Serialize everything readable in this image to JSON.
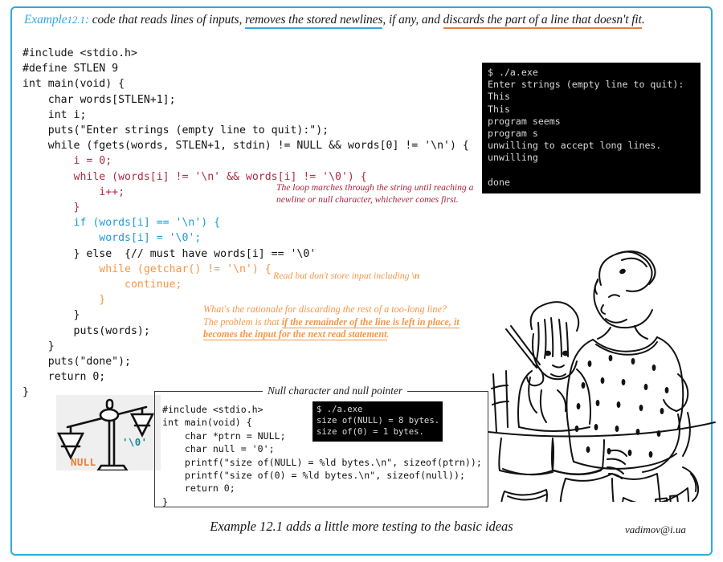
{
  "frame": {
    "border_color": "#2DA9E1"
  },
  "header": {
    "example_label": "Example",
    "example_number": "12.1",
    "colon": ":",
    "part1": " code that reads lines of inputs, ",
    "underline_blue": "removes the stored newlines",
    "part2": ", if any, and ",
    "underline_orange": "discards the part of a line that doesn't fit",
    "part3": "."
  },
  "main_code": {
    "lines": [
      {
        "text": "#include <stdio.h>",
        "color": "black"
      },
      {
        "text": "#define STLEN 9",
        "color": "black"
      },
      {
        "text": "int main(void) {",
        "color": "black"
      },
      {
        "text": "    char words[STLEN+1];",
        "color": "black"
      },
      {
        "text": "    int i;",
        "color": "black"
      },
      {
        "text": "    puts(\"Enter strings (empty line to quit):\");",
        "color": "black"
      },
      {
        "text": "    while (fgets(words, STLEN+1, stdin) != NULL && words[0] != '\\n') {",
        "color": "black"
      },
      {
        "text": "        i = 0;",
        "color": "red"
      },
      {
        "text": "        while (words[i] != '\\n' && words[i] != '\\0') {",
        "color": "red"
      },
      {
        "text": "            i++;",
        "color": "red"
      },
      {
        "text": "        }",
        "color": "red"
      },
      {
        "text": "        if (words[i] == '\\n') {",
        "color": "blue"
      },
      {
        "text": "            words[i] = '\\0';",
        "color": "blue"
      },
      {
        "text": "        } else  {// must have words[i] == '\\0'",
        "color": "black"
      },
      {
        "text": "            while (getchar() != '\\n') {",
        "color": "orange"
      },
      {
        "text": "                continue;",
        "color": "orange"
      },
      {
        "text": "            }",
        "color": "orange"
      },
      {
        "text": "        }",
        "color": "black"
      },
      {
        "text": "        puts(words);",
        "color": "black"
      },
      {
        "text": "    }",
        "color": "black"
      },
      {
        "text": "    puts(\"done\");",
        "color": "black"
      },
      {
        "text": "    return 0;",
        "color": "black"
      },
      {
        "text": "}",
        "color": "black"
      }
    ]
  },
  "terminal_main": {
    "text": "$ ./a.exe\nEnter strings (empty line to quit):\nThis\nThis\nprogram seems\nprogram s\nunwilling to accept long lines.\nunwilling\n\ndone"
  },
  "notes": {
    "loop": "The loop marches through the string until reaching a newline or null character, whichever comes first.",
    "read_prefix": "Read but don't store input including ",
    "read_bold": "\\n",
    "rationale_line1": "What's the rationale for discarding the rest of a too-long line?",
    "rationale_line2_prefix": "The problem is that ",
    "rationale_underlined": "if the remainder of the line is left in place, it becomes the input for the next read statement",
    "rationale_suffix": "."
  },
  "groupbox": {
    "title": "Null character and null pointer",
    "code": "#include <stdio.h>\nint main(void) {\n    char *ptrn = NULL;\n    char null = '0';\n    printf(\"size of(NULL) = %ld bytes.\\n\", sizeof(ptrn));\n    printf(\"size of(0) = %ld bytes.\\n\", sizeof(null));\n    return 0;\n}",
    "terminal": "$ ./a.exe\nsize of(NULL) = 8 bytes.\nsize of(0) = 1 bytes."
  },
  "scales": {
    "label_null": "NULL",
    "label_nullchar": "'\\0'",
    "color_null": "#ED7D31",
    "color_nullchar": "#17869e"
  },
  "footer": {
    "caption": "Example 12.1 adds a little more testing to the basic ideas",
    "email": "vadimov@i.ua"
  },
  "colors": {
    "accent_blue": "#2DA9E1",
    "accent_orange": "#ED7D31",
    "code_red": "#B02B45",
    "code_blue": "#1D9BD7",
    "code_orange": "#F79646"
  }
}
